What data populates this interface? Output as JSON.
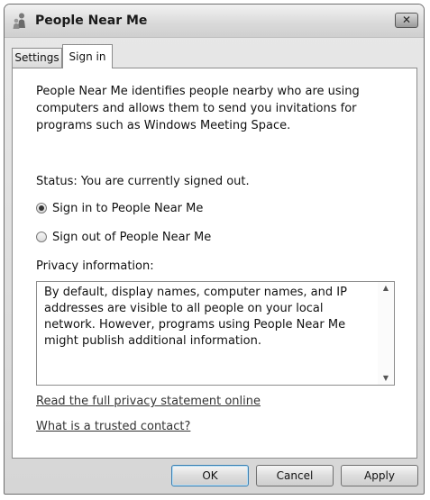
{
  "window": {
    "title": "People Near Me",
    "close_label": "✕",
    "icon": "people-near-me-icon"
  },
  "tabs": [
    {
      "label": "Settings",
      "selected": false
    },
    {
      "label": "Sign in",
      "selected": true
    }
  ],
  "panel": {
    "description": "People Near Me identifies people nearby who are using computers and allows them to send you invitations for programs such as Windows Meeting Space.",
    "status": "Status: You are currently signed out.",
    "radio_options": [
      {
        "label": "Sign in to People Near Me",
        "selected": true
      },
      {
        "label": "Sign out of People Near Me",
        "selected": false
      }
    ],
    "privacy_label": "Privacy information:",
    "privacy_text": "By default, display names, computer names, and IP addresses are visible to all people on your local network. However, programs using People Near Me might publish additional information.",
    "links": [
      "Read the full privacy statement online",
      "What is a trusted contact?"
    ]
  },
  "buttons": {
    "ok": "OK",
    "cancel": "Cancel",
    "apply": "Apply"
  }
}
